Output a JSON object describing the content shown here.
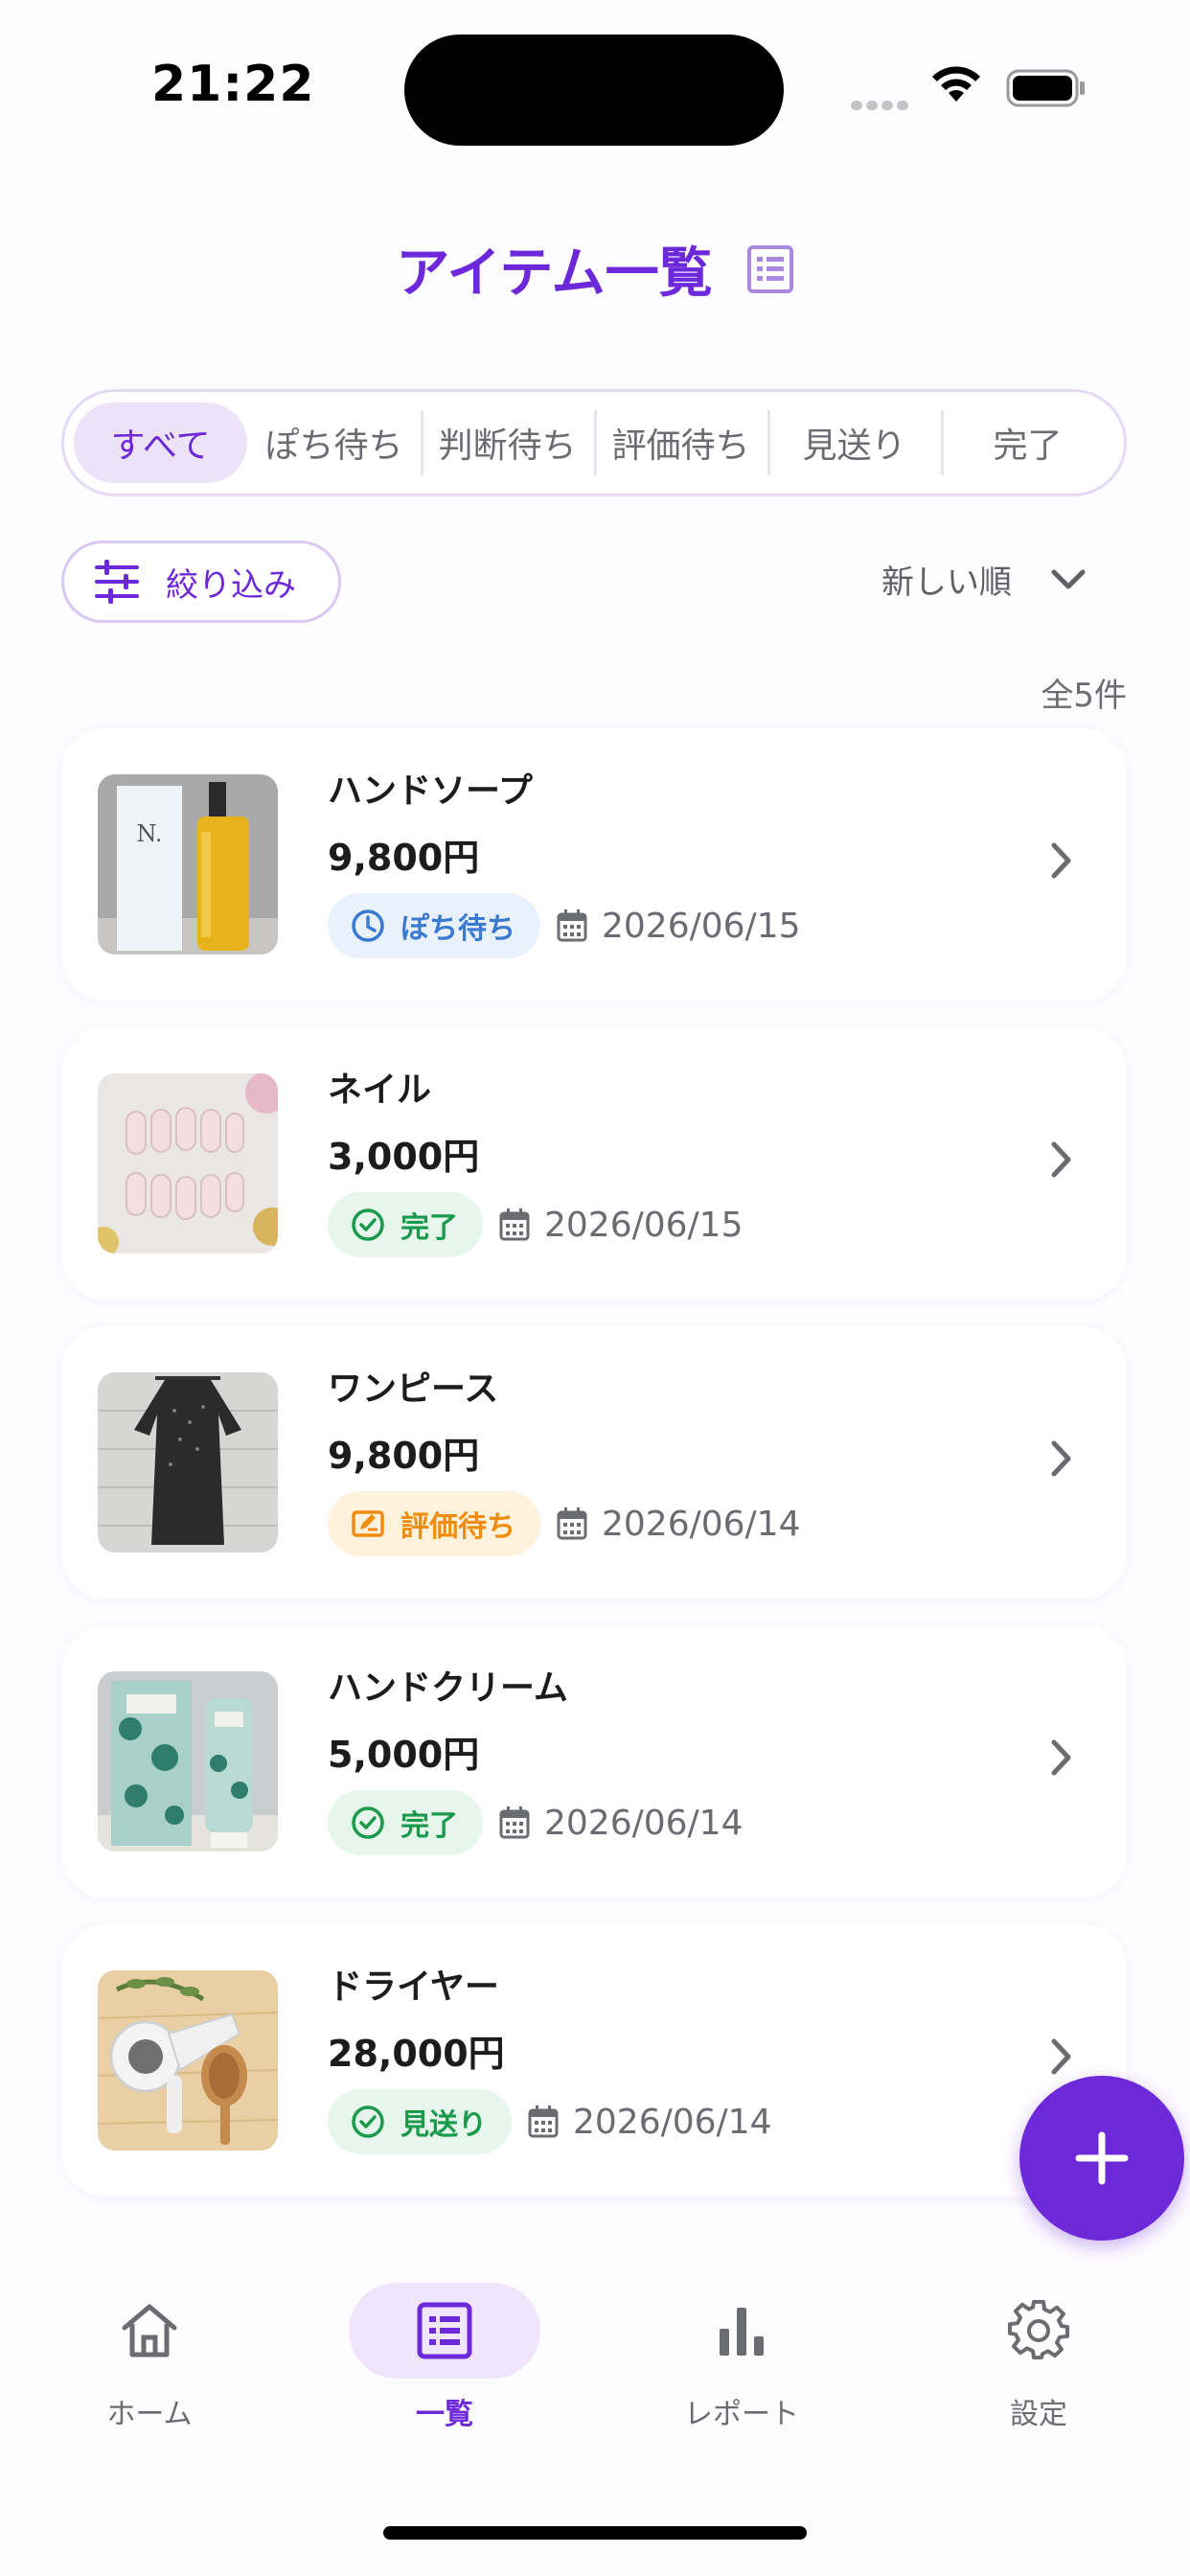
{
  "status_bar": {
    "time": "21:22"
  },
  "header": {
    "title": "アイテム一覧"
  },
  "tabs": [
    {
      "label": "すべて",
      "active": true
    },
    {
      "label": "ぽち待ち",
      "active": false
    },
    {
      "label": "判断待ち",
      "active": false
    },
    {
      "label": "評価待ち",
      "active": false
    },
    {
      "label": "見送り",
      "active": false
    },
    {
      "label": "完了",
      "active": false
    }
  ],
  "filter": {
    "label": "絞り込み"
  },
  "sort": {
    "selected": "新しい順"
  },
  "count_label": "全5件",
  "items": [
    {
      "name": "ハンドソープ",
      "price": "9,800円",
      "status": "ぽち待ち",
      "status_type": "waiting",
      "date": "2026/06/15",
      "thumb": "hand-soap-photo"
    },
    {
      "name": "ネイル",
      "price": "3,000円",
      "status": "完了",
      "status_type": "done",
      "date": "2026/06/15",
      "thumb": "nail-photo"
    },
    {
      "name": "ワンピース",
      "price": "9,800円",
      "status": "評価待ち",
      "status_type": "eval",
      "date": "2026/06/14",
      "thumb": "dress-photo"
    },
    {
      "name": "ハンドクリーム",
      "price": "5,000円",
      "status": "完了",
      "status_type": "done",
      "date": "2026/06/14",
      "thumb": "hand-cream-photo"
    },
    {
      "name": "ドライヤー",
      "price": "28,000円",
      "status": "見送り",
      "status_type": "done",
      "date": "2026/06/14",
      "thumb": "dryer-photo"
    }
  ],
  "bottom_nav": [
    {
      "label": "ホーム",
      "icon": "home-icon",
      "active": false
    },
    {
      "label": "一覧",
      "icon": "list-icon",
      "active": true
    },
    {
      "label": "レポート",
      "icon": "bar-chart-icon",
      "active": false
    },
    {
      "label": "設定",
      "icon": "gear-icon",
      "active": false
    }
  ],
  "colors": {
    "accent": "#6d28d9",
    "waiting": "#3a7ad0",
    "done": "#1a9a4a",
    "eval": "#ef8c0e"
  }
}
